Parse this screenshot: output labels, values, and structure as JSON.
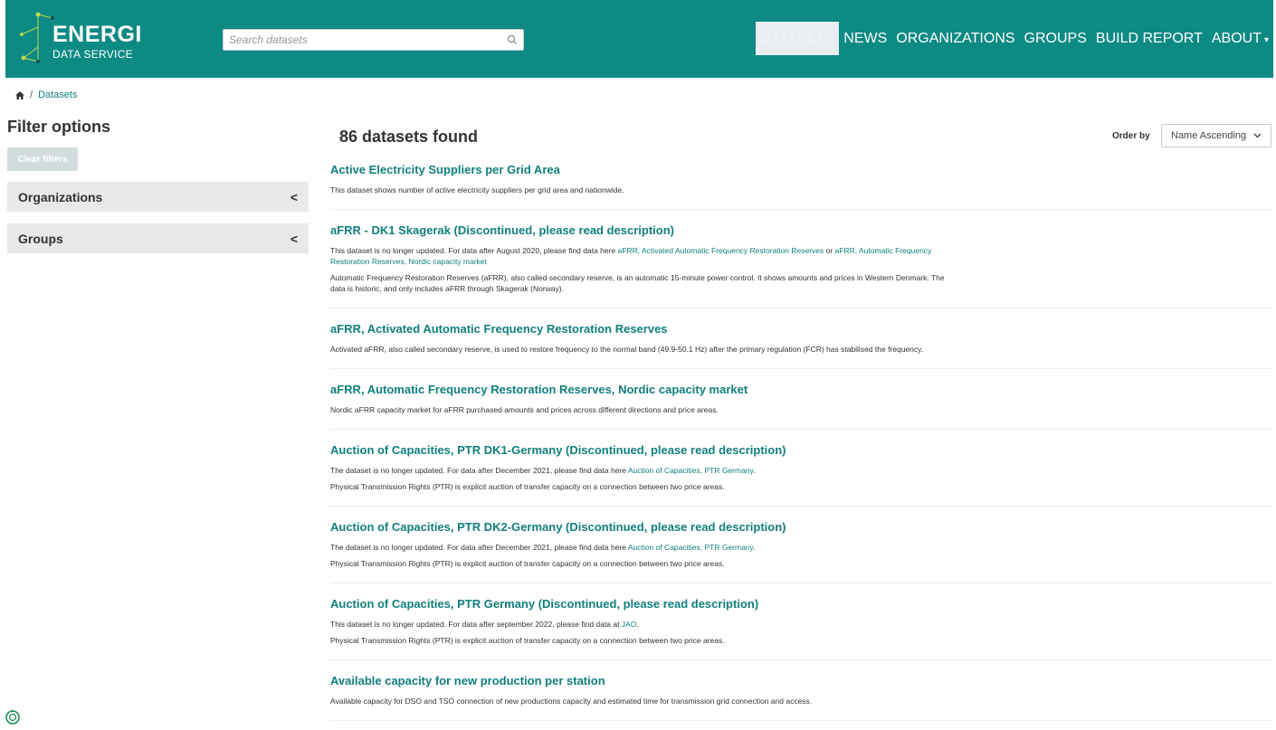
{
  "header": {
    "logo_title": "ENERGI",
    "logo_subtitle": "DATA SERVICE",
    "search_placeholder": "Search datasets",
    "nav": [
      "DATASETS",
      "NEWS",
      "ORGANIZATIONS",
      "GROUPS",
      "BUILD REPORT",
      "ABOUT"
    ],
    "brand_color": "#0e8a85"
  },
  "breadcrumb": {
    "sep": "/",
    "current": "Datasets"
  },
  "sidebar": {
    "title": "Filter options",
    "clear_label": "Clear filters",
    "facets": [
      {
        "label": "Organizations",
        "toggle": "<"
      },
      {
        "label": "Groups",
        "toggle": "<"
      }
    ]
  },
  "main": {
    "count_text": "86 datasets found",
    "order_label": "Order by",
    "order_value": "Name Ascending"
  },
  "datasets": [
    {
      "title": "Active Electricity Suppliers per Grid Area",
      "desc": "This dataset shows number of active electricity suppliers per grid area and nationwide."
    },
    {
      "title": "aFRR - DK1 Skagerak (Discontinued, please read description)",
      "note_pre": "This dataset is no longer updated. For data after August 2020, please find data here ",
      "link1": "aFRR, Activated Automatic Frequency Restoration Reserves",
      "note_mid": " or ",
      "link2": "aFRR, Automatic Frequency Restoration Reserves, Nordic capacity market",
      "desc": "Automatic Frequency Restoration Reserves (aFRR), also called secondary reserve, is an automatic 15-minute power control. It shows amounts and prices in Western Denmark. The data is historic, and only includes aFRR through Skagerak (Norway)."
    },
    {
      "title": "aFRR, Activated Automatic Frequency Restoration Reserves",
      "desc": "Activated aFRR, also called secondary reserve, is used to restore frequency to the normal band (49.9-50.1 Hz) after the primary regulation (FCR) has stabilised the frequency."
    },
    {
      "title": "aFRR, Automatic Frequency Restoration Reserves, Nordic capacity market",
      "desc": "Nordic aFRR capacity market for aFRR purchased amounts and prices across different directions and price areas."
    },
    {
      "title": "Auction of Capacities, PTR DK1-Germany (Discontinued, please read description)",
      "note_pre": "The dataset is no longer updated. For data after December 2021, please find data here ",
      "link1": "Auction of Capacities, PTR Germany",
      "note_post": ".",
      "desc": "Physical Transmission Rights (PTR) is explicit auction of transfer capacity on a connection between two price areas."
    },
    {
      "title": "Auction of Capacities, PTR DK2-Germany (Discontinued, please read description)",
      "note_pre": "The dataset is no longer updated. For data after December 2021, please find data here ",
      "link1": "Auction of Capacities, PTR Germany",
      "note_post": ".",
      "desc": "Physical Transmission Rights (PTR) is explicit auction of transfer capacity on a connection between two price areas."
    },
    {
      "title": "Auction of Capacities, PTR Germany (Discontinued, please read description)",
      "note_pre": "This dataset is no longer updated. For data after september 2022, please find data at ",
      "link1": "JAO",
      "note_post": ".",
      "desc": "Physical Transmission Rights (PTR) is explicit auction of transfer capacity on a connection between two price areas."
    },
    {
      "title": "Available capacity for new production per station",
      "desc": "Available capacity for DSO and TSO connection of new productions capacity and estimated time for transmission grid connection and access."
    }
  ]
}
